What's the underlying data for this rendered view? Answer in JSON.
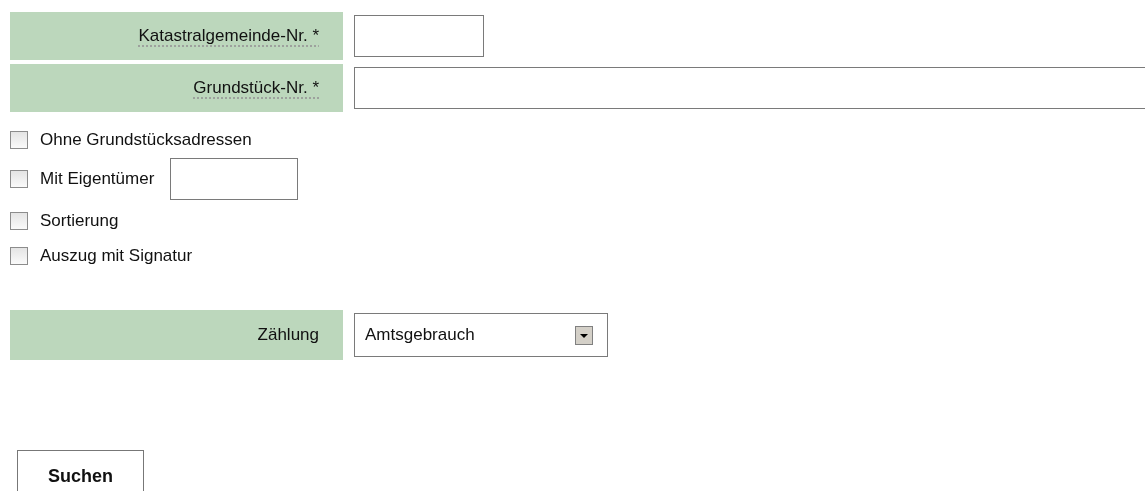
{
  "fields": [
    {
      "label": "Katastralgemeinde-Nr. *",
      "kind": "short"
    },
    {
      "label": "Grundstück-Nr. *",
      "kind": "long"
    }
  ],
  "options": [
    {
      "label": "Ohne Grundstücksadressen",
      "checked": false,
      "kind": "plain"
    },
    {
      "label": "Mit Eigentümer",
      "checked": false,
      "kind": "with-input"
    },
    {
      "label": "Sortierung",
      "checked": false,
      "kind": "plain"
    },
    {
      "label": "Auszug mit Signatur",
      "checked": false,
      "kind": "plain"
    }
  ],
  "count": {
    "label": "Zählung",
    "value": "Amtsgebrauch"
  },
  "submit": "Suchen"
}
